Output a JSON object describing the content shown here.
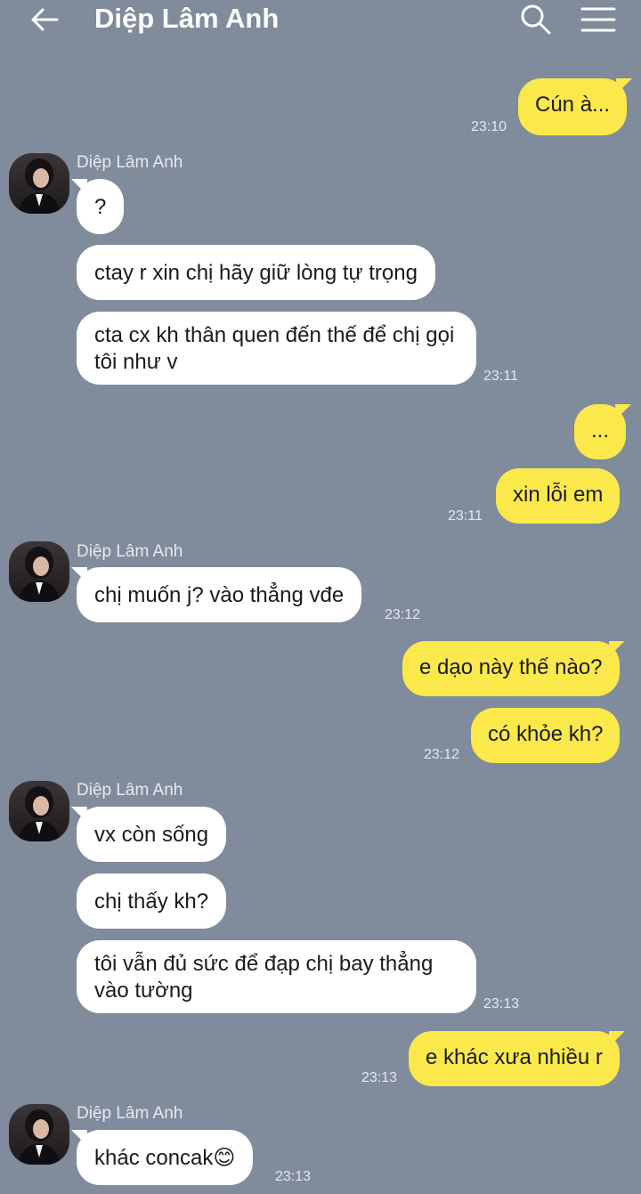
{
  "header": {
    "title": "Diệp Lâm Anh"
  },
  "contact": {
    "name": "Diệp Lâm Anh"
  },
  "messages": {
    "m1": {
      "text": "Cún à...",
      "time": "23:10"
    },
    "m2": {
      "text": "?"
    },
    "m3": {
      "text": "ctay r xin chị hãy giữ lòng tự trọng"
    },
    "m4": {
      "text": "cta cx kh thân quen đến thế để chị gọi tôi như v",
      "time": "23:11"
    },
    "m5": {
      "text": "..."
    },
    "m6": {
      "text": "xin lỗi em",
      "time": "23:11"
    },
    "m7": {
      "text": "chị muốn j? vào thẳng vđe",
      "time": "23:12"
    },
    "m8": {
      "text": "e dạo này thế nào?"
    },
    "m9": {
      "text": "có khỏe kh?",
      "time": "23:12"
    },
    "m10": {
      "text": "vx còn sống"
    },
    "m11": {
      "text": "chị thấy kh?"
    },
    "m12": {
      "text": "tôi vẫn đủ sức để đạp chị bay thẳng vào tường",
      "time": "23:13"
    },
    "m13": {
      "text": "e khác xưa nhiều r",
      "time": "23:13"
    },
    "m14": {
      "text": "khác concak",
      "emoji": "😊",
      "time": "23:13"
    }
  },
  "colors": {
    "background": "#808b9c",
    "incoming_bubble": "#ffffff",
    "outgoing_bubble": "#fbe94c"
  },
  "icons": [
    "back-arrow-icon",
    "search-icon",
    "menu-icon"
  ]
}
